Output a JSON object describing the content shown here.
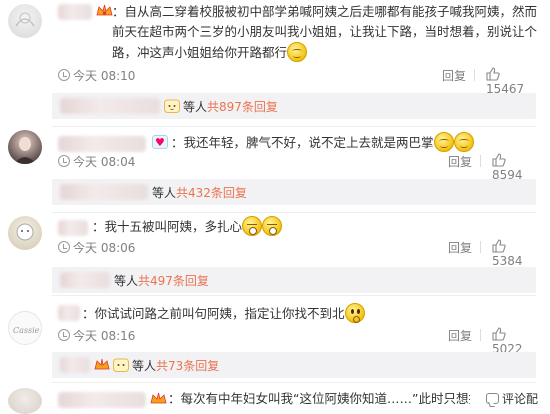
{
  "colors": {
    "accent": "#eb7350",
    "meta": "#808080",
    "reply_bg": "#f2f2f5"
  },
  "comments": [
    {
      "badge_icon": "vip-crown-icon",
      "text": "：自从高二穿着校服被初中部学弟喊阿姨之后走哪都有能孩子喊我阿姨，然而前天在超市两个三岁的小朋友叫我小姐姐，让我让下路，当时想着，别说让个路，冲这声小姐姐给你开路都行",
      "emoji": "smile-emoji",
      "time": "今天 08:10",
      "reply_label": "回复",
      "likes": "15467",
      "reply_prefix": "等人",
      "reply_count": "共897条回复"
    },
    {
      "badge_icon": "heart-badge-icon",
      "text": "：我还年轻，脾气不好，说不定上去就是两巴掌",
      "emoji": "smile-emoji",
      "time": "今天 08:04",
      "reply_label": "回复",
      "likes": "8594",
      "reply_prefix": "等人",
      "reply_count": "共432条回复"
    },
    {
      "badge_icon": "",
      "text": "：我十五被叫阿姨，多扎心",
      "emoji": "cry-emoji",
      "time": "今天 08:06",
      "reply_label": "回复",
      "likes": "5384",
      "reply_prefix": "等人",
      "reply_count": "共497条回复"
    },
    {
      "badge_icon": "",
      "text": "：你试试问路之前叫句阿姨，指定让你找不到北",
      "emoji": "think-emoji",
      "time": "今天 08:16",
      "reply_label": "回复",
      "likes": "5022",
      "reply_prefix": "等人",
      "reply_count": "共73条回复"
    },
    {
      "badge_icon": "vip-crown-icon",
      "text": "：每次有中年妇女叫我“这位阿姨你知道……”此时只想提起大刀"
    }
  ],
  "footer": {
    "comment_button": "评论配"
  }
}
